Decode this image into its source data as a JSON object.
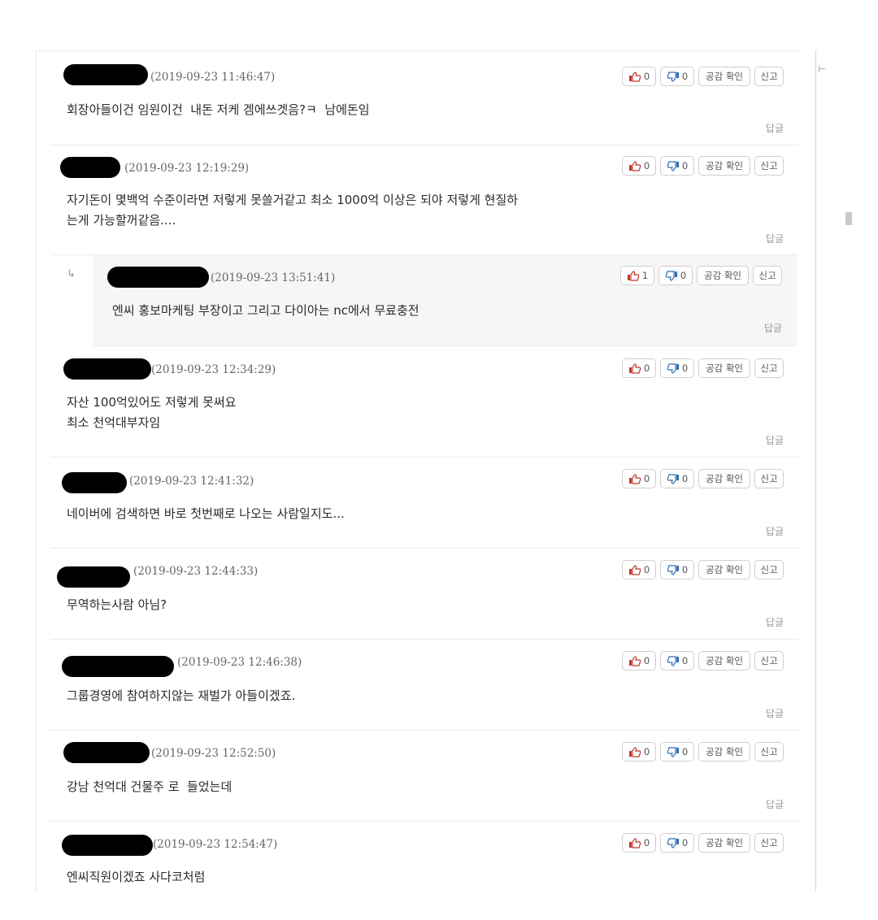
{
  "buttons": {
    "confirm_label": "공감 확인",
    "report_label": "신고",
    "reply_label": "답글",
    "reply_arrow": "↳"
  },
  "colors": {
    "like": "#c0392b",
    "dislike": "#2f6fb0",
    "redaction": "#000000"
  },
  "icons": {
    "like": "thumbs-up-icon",
    "dislike": "thumbs-down-icon"
  },
  "comments": [
    {
      "date": "(2019-09-23 11:46:47)",
      "text": "회장아들이건 임원이건  내돈 저케 겜에쓰겟음?ㅋ  남에돈임",
      "likes": "0",
      "dislikes": "0"
    },
    {
      "date": "(2019-09-23 12:19:29)",
      "text": "자기돈이 몇백억 수준이라면 저렇게 못쓸거같고 최소 1000억 이상은 되야 저렇게 현질하\n는게 가능할꺼같음....",
      "likes": "0",
      "dislikes": "0"
    },
    {
      "date": "(2019-09-23 13:51:41)",
      "text": "엔씨 홍보마케팅 부장이고 그리고 다이아는 nc에서 무료충전",
      "likes": "1",
      "dislikes": "0"
    },
    {
      "date": "(2019-09-23 12:34:29)",
      "text": "자산 100억있어도 저렇게 못써요\n최소 천억대부자임",
      "likes": "0",
      "dislikes": "0"
    },
    {
      "date": "(2019-09-23 12:41:32)",
      "text": "네이버에 검색하면 바로 첫번째로 나오는 사람일지도...",
      "likes": "0",
      "dislikes": "0"
    },
    {
      "date": "(2019-09-23 12:44:33)",
      "text": "무역하는사람 아님?",
      "likes": "0",
      "dislikes": "0"
    },
    {
      "date": "(2019-09-23 12:46:38)",
      "text": "그룹경영에 참여하지않는 재벌가 아들이겠죠.",
      "likes": "0",
      "dislikes": "0"
    },
    {
      "date": "(2019-09-23 12:52:50)",
      "text": "강남 천억대 건물주 로  들었는데",
      "likes": "0",
      "dislikes": "0"
    },
    {
      "date": "(2019-09-23 12:54:47)",
      "text": "엔씨직원이겠죠 사다코처럼",
      "likes": "0",
      "dislikes": "0"
    }
  ]
}
